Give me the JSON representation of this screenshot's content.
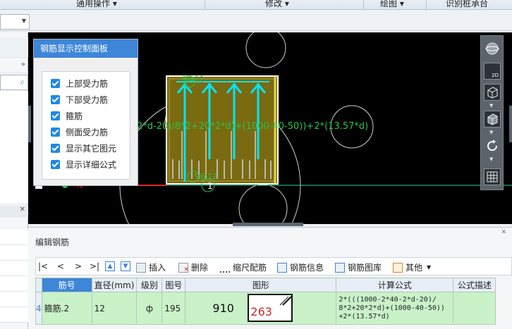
{
  "toolbar": {
    "groups": [
      {
        "label": "通用操作",
        "has_menu": true
      },
      {
        "label": "修改",
        "has_menu": true
      },
      {
        "label": "绘图",
        "has_menu": true
      },
      {
        "label": "识别桩承台",
        "has_menu": false
      }
    ]
  },
  "canvas": {
    "formula_text": "2*d-20)/8*2+20*2*d)+(1000-40-50))+2*(13.57*d)",
    "dim_top": "9@12",
    "dim_bottom": "9@12",
    "origin_label": "1"
  },
  "control_panel": {
    "title": "钢筋显示控制面板",
    "options": [
      {
        "label": "上部受力筋",
        "checked": true
      },
      {
        "label": "下部受力筋",
        "checked": true
      },
      {
        "label": "箍筋",
        "checked": true
      },
      {
        "label": "侧面受力筋",
        "checked": true
      },
      {
        "label": "显示其它图元",
        "checked": true
      },
      {
        "label": "显示详细公式",
        "checked": true
      }
    ]
  },
  "view_tools": {
    "buttons": [
      "globe-icon",
      "2d-view-icon",
      "cube-wireframe-icon",
      "cube-solid-icon",
      "rotate-icon",
      "grid-settings-icon"
    ],
    "label_2d": "2D"
  },
  "edit_panel": {
    "title": "编辑钢筋",
    "nav": [
      "|<",
      "<",
      ">",
      ">|"
    ],
    "actions": [
      {
        "label": "插入",
        "icon": "insert-icon"
      },
      {
        "label": "删除",
        "icon": "delete-icon"
      },
      {
        "label": "缩尺配筋",
        "icon": "scale-icon"
      },
      {
        "label": "钢筋信息",
        "icon": "info-icon"
      },
      {
        "label": "钢筋图库",
        "icon": "library-icon"
      },
      {
        "label": "其他",
        "icon": "other-icon",
        "has_menu": true
      }
    ],
    "columns": [
      "筋号",
      "直径(mm)",
      "级别",
      "图号",
      "图形",
      "计算公式",
      "公式描述"
    ],
    "rows": [
      {
        "index": "4",
        "name": "箍筋.2",
        "diameter": "12",
        "grade": "ф",
        "figure_no": "195",
        "shape_length": "910",
        "shape_width": "263",
        "formula": "2*(((1000-2*40-2*d-20)/\n8*2+20*2*d)+(1000-40-50))\n+2*(13.57*d)",
        "description": ""
      }
    ]
  },
  "colors": {
    "accent": "#3d86d8",
    "rebar": "#00e5ff",
    "row_highlight": "#c9f2c9",
    "concrete": "#7a6a10"
  }
}
